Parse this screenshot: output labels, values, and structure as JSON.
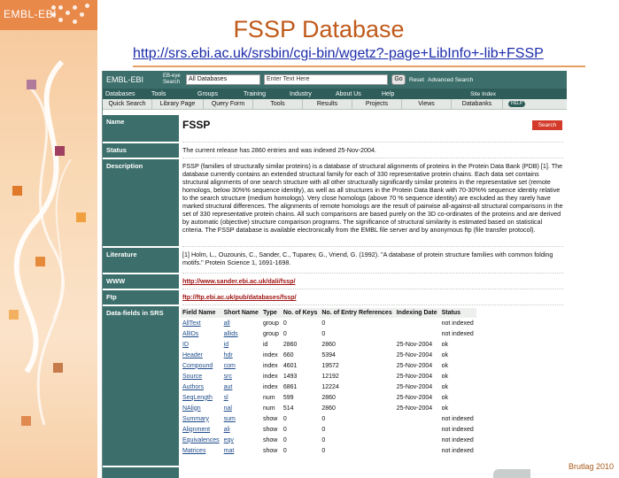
{
  "slide": {
    "brand": "EMBL-EBI",
    "title": "FSSP Database",
    "url": "http://srs.ebi.ac.uk/srsbin/cgi-bin/wgetz?-page+LibInfo+-lib+FSSP",
    "footer": "Brutlag 2010"
  },
  "srs": {
    "logo": "EMBL-EBI",
    "eb_search": "EB-eye Search",
    "db_select": "All Databases",
    "search_placeholder": "Enter Text Here",
    "go": "Go",
    "reset": "Reset",
    "advanced": "Advanced Search",
    "menu": [
      "Databases",
      "Tools",
      "Groups",
      "Training",
      "Industry",
      "About Us",
      "Help"
    ],
    "site_index": "Site Index",
    "tabs": [
      "Quick Search",
      "Library Page",
      "Query Form",
      "Tools",
      "Results",
      "Projects",
      "Views",
      "Databanks"
    ],
    "help_badge": "HELP"
  },
  "info": {
    "name_label": "Name",
    "name_value": "FSSP",
    "search_button": "Search",
    "status_label": "Status",
    "status_value": "The current release has 2860 entries and was indexed 25-Nov-2004.",
    "description_label": "Description",
    "description_value": "FSSP (families of structurally similar proteins) is a database of structural alignments of proteins in the Protein Data Bank (PDB) [1]. The database currently contains an extended structural family for each of 330 representative protein chains. Each data set contains structural alignments of one search structure with all other structurally significantly similar proteins in the representative set (remote homologs, below 30%% sequence identity), as well as all structures in the Protein Data Bank with 70-30%% sequence identity relative to the search structure (medium homologs). Very close homologs (above 70 % sequence identity) are excluded as they rarely have marked structural differences. The alignments of remote homologs are the result of pairwise all-against-all structural comparisons in the set of 330 representative protein chains. All such comparisons are based purely on the 3D co-ordinates of the proteins and are derived by automatic (objective) structure comparison programs. The significance of structural similarity is estimated based on statistical criteria. The FSSP database is available electronically from the EMBL file server and by anonymous ftp (file transfer protocol).",
    "literature_label": "Literature",
    "literature_value": "[1] Holm, L., Ouzounis, C., Sander, C., Tuparev, G., Vriend, G. (1992). \"A database of protein structure families with common folding motifs.\" Protein Science 1, 1691-1698.",
    "www_label": "WWW",
    "www_value": "http://www.sander.ebi.ac.uk/dali/fssp/",
    "ftp_label": "Ftp",
    "ftp_value": "ftp://ftp.ebi.ac.uk/pub/databases/fssp/",
    "fields_label": "Data-fields in SRS"
  },
  "fields_table": {
    "headers": [
      "Field Name",
      "Short Name",
      "Type",
      "No. of Keys",
      "No. of Entry References",
      "Indexing Date",
      "Status"
    ],
    "rows": [
      [
        "AllText",
        "all",
        "group",
        "0",
        "0",
        "",
        "not indexed"
      ],
      [
        "AllIDs",
        "allids",
        "group",
        "0",
        "0",
        "",
        "not indexed"
      ],
      [
        "ID",
        "id",
        "id",
        "2860",
        "2860",
        "25-Nov-2004",
        "ok"
      ],
      [
        "Header",
        "hdr",
        "index",
        "660",
        "5394",
        "25-Nov-2004",
        "ok"
      ],
      [
        "Compound",
        "com",
        "index",
        "4601",
        "19572",
        "25-Nov-2004",
        "ok"
      ],
      [
        "Source",
        "src",
        "index",
        "1493",
        "12192",
        "25-Nov-2004",
        "ok"
      ],
      [
        "Authors",
        "aut",
        "index",
        "6861",
        "12224",
        "25-Nov-2004",
        "ok"
      ],
      [
        "SeqLength",
        "sl",
        "num",
        "599",
        "2860",
        "25-Nov-2004",
        "ok"
      ],
      [
        "NAlign",
        "nal",
        "num",
        "514",
        "2860",
        "25-Nov-2004",
        "ok"
      ],
      [
        "Summary",
        "sum",
        "show",
        "0",
        "0",
        "",
        "not indexed"
      ],
      [
        "Alignment",
        "ali",
        "show",
        "0",
        "0",
        "",
        "not indexed"
      ],
      [
        "Equivalences",
        "eqv",
        "show",
        "0",
        "0",
        "",
        "not indexed"
      ],
      [
        "Matrices",
        "mat",
        "show",
        "0",
        "0",
        "",
        "not indexed"
      ]
    ]
  },
  "colors": {
    "accent_teal": "#3c6f6b",
    "title_orange": "#c05a1a",
    "link_red": "#a11414",
    "search_red": "#d43a2a"
  }
}
